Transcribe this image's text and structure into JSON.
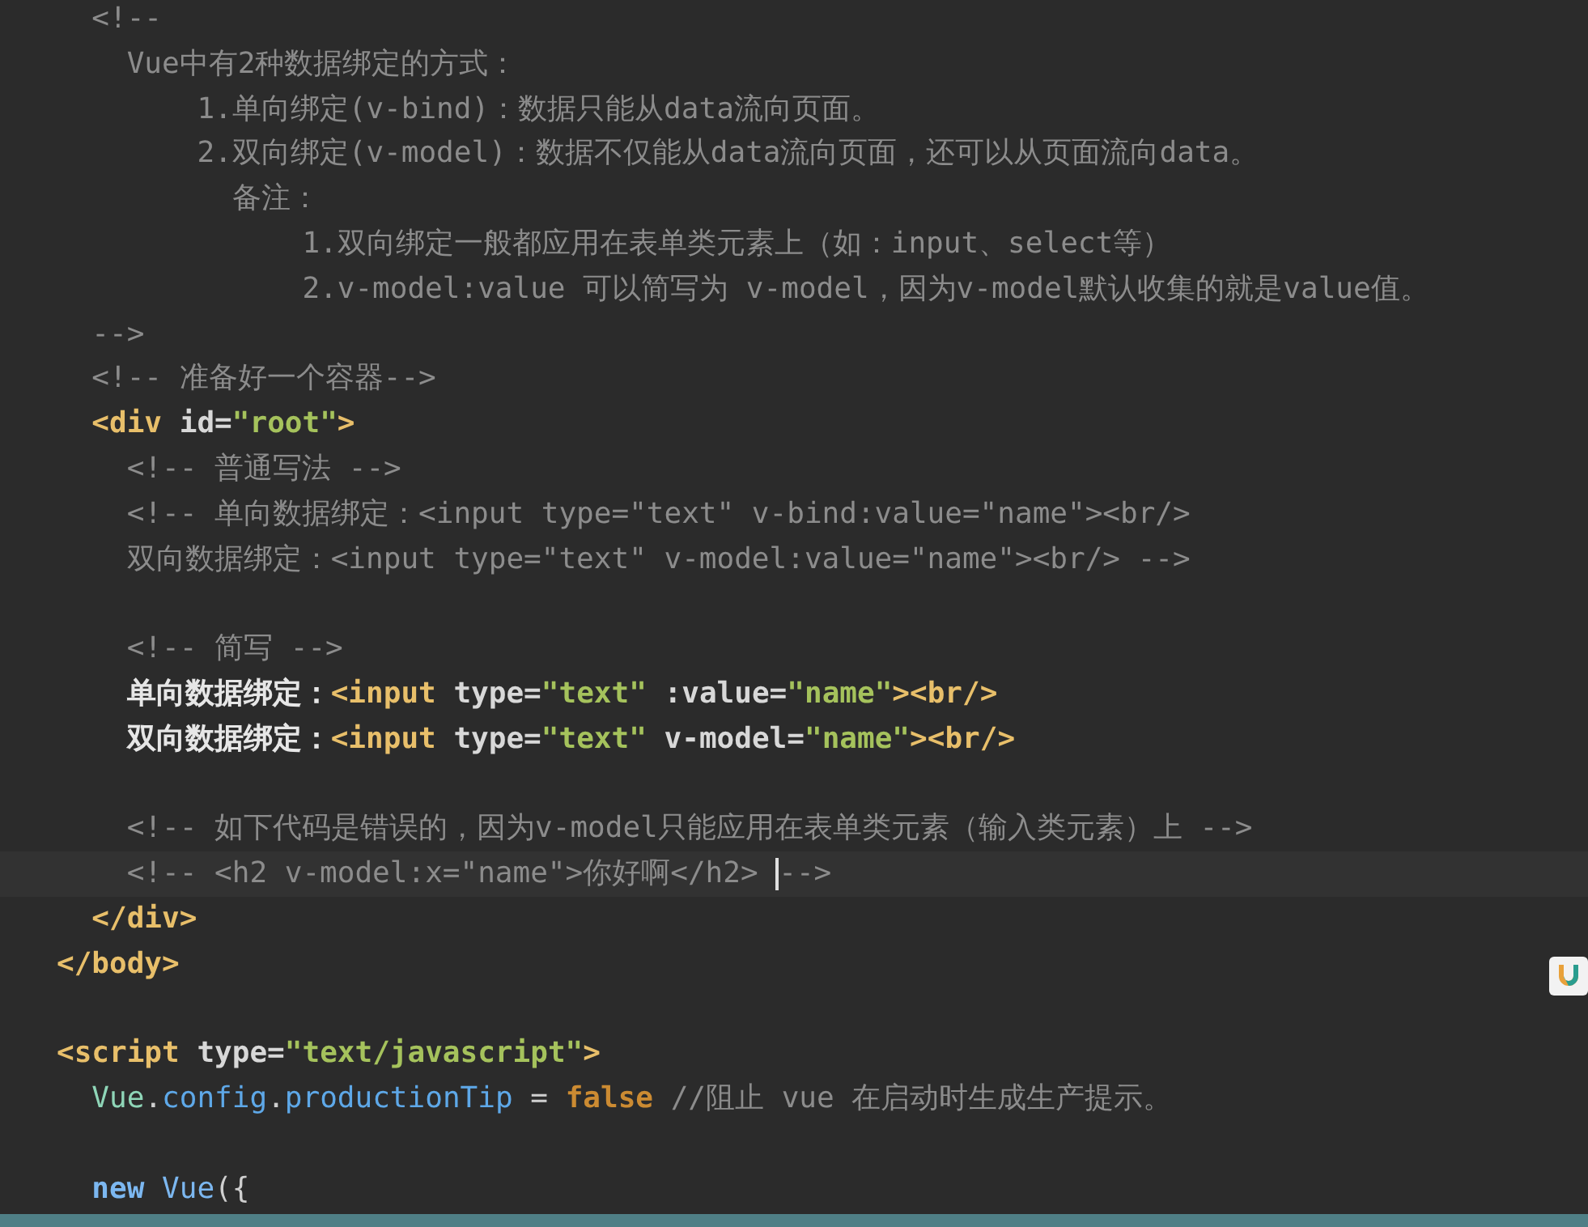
{
  "editor": {
    "lines": [
      {
        "children": [
          {
            "kind": "code",
            "tokens": [
              {
                "kind": "comment",
                "text": "<!--"
              }
            ]
          },
          {
            "children": [
              {
                "kind": "code",
                "tokens": [
                  {
                    "kind": "comment",
                    "text": "Vue中有2种数据绑定的方式："
                  }
                ]
              },
              {
                "children": [
                  {
                    "children": [
                      {
                        "kind": "code",
                        "tokens": [
                          {
                            "kind": "comment",
                            "text": "1.单向绑定(v-bind)：数据只能从data流向页面。"
                          }
                        ]
                      },
                      {
                        "kind": "code",
                        "tokens": [
                          {
                            "kind": "comment",
                            "text": "2.双向绑定(v-model)：数据不仅能从data流向页面，还可以从页面流向data。"
                          }
                        ]
                      },
                      {
                        "children": [
                          {
                            "kind": "code",
                            "tokens": [
                              {
                                "kind": "comment",
                                "text": "备注："
                              }
                            ]
                          },
                          {
                            "children": [
                              {
                                "children": [
                                  {
                                    "kind": "code",
                                    "tokens": [
                                      {
                                        "kind": "comment",
                                        "text": "1.双向绑定一般都应用在表单类元素上（如：input、select等）"
                                      }
                                    ]
                                  },
                                  {
                                    "kind": "code",
                                    "tokens": [
                                      {
                                        "kind": "comment",
                                        "text": "2.v-model:value 可以简写为 v-model，因为v-model默认收集的就是value值。"
                                      }
                                    ]
                                  }
                                ]
                              }
                            ]
                          }
                        ]
                      }
                    ]
                  }
                ]
              }
            ]
          },
          {
            "kind": "code",
            "tokens": [
              {
                "kind": "comment",
                "text": "-->"
              }
            ]
          },
          {
            "kind": "code",
            "tokens": [
              {
                "kind": "comment",
                "text": "<!-- 准备好一个容器-->"
              }
            ]
          },
          {
            "kind": "code",
            "tokens": [
              {
                "kind": "tag",
                "text": "<div"
              },
              {
                "kind": "attr",
                "text": " id="
              },
              {
                "kind": "string",
                "text": "\"root\""
              },
              {
                "kind": "tag",
                "text": ">"
              }
            ]
          },
          {
            "children": [
              {
                "kind": "code",
                "tokens": [
                  {
                    "kind": "comment",
                    "text": "<!-- 普通写法 -->"
                  }
                ]
              },
              {
                "kind": "code",
                "tokens": [
                  {
                    "kind": "comment",
                    "text": "<!-- 单向数据绑定：<input type=\"text\" v-bind:value=\"name\"><br/>"
                  }
                ]
              },
              {
                "kind": "code",
                "tokens": [
                  {
                    "kind": "comment",
                    "text": "双向数据绑定：<input type=\"text\" v-model:value=\"name\"><br/> -->"
                  }
                ]
              },
              {
                "kind": "blank"
              },
              {
                "kind": "code",
                "tokens": [
                  {
                    "kind": "comment",
                    "text": "<!-- 简写 -->"
                  }
                ]
              },
              {
                "kind": "code",
                "tokens": [
                  {
                    "kind": "text",
                    "text": "单向数据绑定："
                  },
                  {
                    "kind": "tag",
                    "text": "<input"
                  },
                  {
                    "kind": "attr",
                    "text": " type="
                  },
                  {
                    "kind": "string",
                    "text": "\"text\""
                  },
                  {
                    "kind": "attr",
                    "text": " :value="
                  },
                  {
                    "kind": "string",
                    "text": "\"name\""
                  },
                  {
                    "kind": "tag",
                    "text": "><br/>"
                  }
                ]
              },
              {
                "kind": "code",
                "tokens": [
                  {
                    "kind": "text",
                    "text": "双向数据绑定："
                  },
                  {
                    "kind": "tag",
                    "text": "<input"
                  },
                  {
                    "kind": "attr",
                    "text": " type="
                  },
                  {
                    "kind": "string",
                    "text": "\"text\""
                  },
                  {
                    "kind": "attr",
                    "text": " v-model="
                  },
                  {
                    "kind": "string",
                    "text": "\"name\""
                  },
                  {
                    "kind": "tag",
                    "text": "><br/>"
                  }
                ]
              },
              {
                "kind": "blank"
              },
              {
                "kind": "code",
                "tokens": [
                  {
                    "kind": "comment",
                    "text": "<!-- 如下代码是错误的，因为v-model只能应用在表单类元素（输入类元素）上 -->"
                  }
                ]
              },
              {
                "kind": "code",
                "current": true,
                "tokens": [
                  {
                    "kind": "comment",
                    "text": "<!-- <h2 v-model:x=\"name\">你好啊</h2> "
                  },
                  {
                    "kind": "comment",
                    "text": "-->",
                    "caret_before": true
                  }
                ]
              }
            ]
          },
          {
            "kind": "code",
            "tokens": [
              {
                "kind": "tag",
                "text": "</div>"
              }
            ]
          }
        ]
      },
      {
        "kind": "code",
        "tokens": [
          {
            "kind": "tag",
            "text": "</body>"
          }
        ]
      },
      {
        "kind": "blank"
      },
      {
        "kind": "code",
        "tokens": [
          {
            "kind": "tag",
            "text": "<script"
          },
          {
            "kind": "attr",
            "text": " type="
          },
          {
            "kind": "string",
            "text": "\"text/javascript\""
          },
          {
            "kind": "tag",
            "text": ">"
          }
        ]
      },
      {
        "children": [
          {
            "kind": "code",
            "tokens": [
              {
                "kind": "ident",
                "text": "Vue"
              },
              {
                "kind": "punct",
                "text": "."
              },
              {
                "kind": "prop",
                "text": "config"
              },
              {
                "kind": "punct",
                "text": "."
              },
              {
                "kind": "prop",
                "text": "productionTip"
              },
              {
                "kind": "punct",
                "text": " = "
              },
              {
                "kind": "keyword",
                "text": "false"
              },
              {
                "kind": "comment",
                "text": " //阻止 vue 在启动时生成生产提示。"
              }
            ]
          },
          {
            "kind": "blank"
          },
          {
            "kind": "code",
            "tokens": [
              {
                "kind": "keyword2",
                "text": "new"
              },
              {
                "kind": "ident2",
                "text": "Vue"
              },
              {
                "kind": "punct",
                "text": "({"
              }
            ]
          }
        ]
      }
    ]
  }
}
